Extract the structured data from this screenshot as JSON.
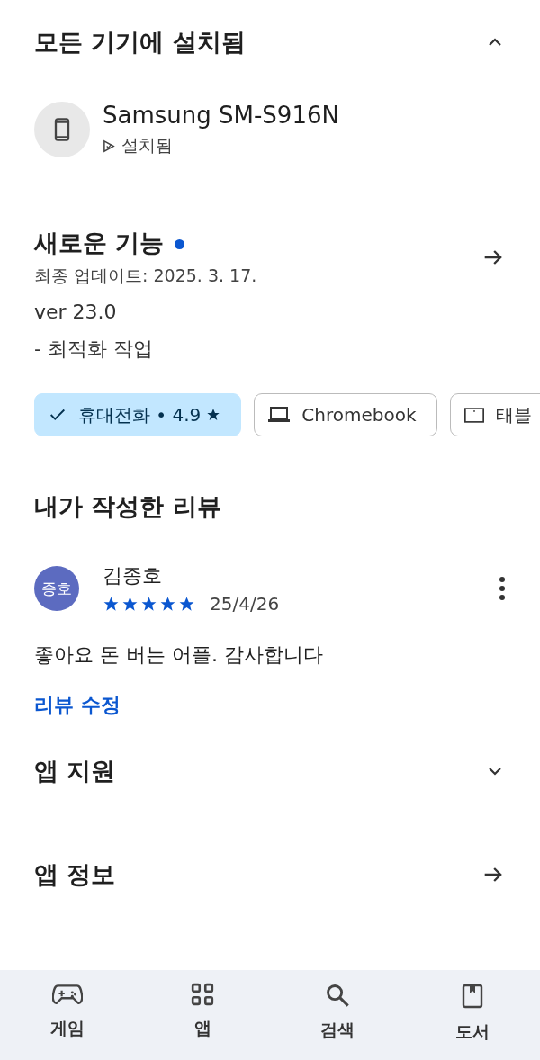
{
  "installed_section": {
    "title": "모든 기기에 설치됨",
    "expanded": true,
    "devices": [
      {
        "name": "Samsung SM-S916N",
        "status": "설치됨"
      }
    ]
  },
  "whats_new": {
    "title": "새로운 기능",
    "new_badge": true,
    "updated": "최종 업데이트: 2025. 3. 17.",
    "lines": [
      "ver 23.0",
      "- 최적화 작업"
    ]
  },
  "device_chips": [
    {
      "kind": "phone",
      "label": "휴대전화 • 4.9",
      "selected": true
    },
    {
      "kind": "laptop",
      "label": "Chromebook",
      "selected": false
    },
    {
      "kind": "tablet",
      "label": "태블",
      "selected": false
    }
  ],
  "my_review": {
    "title": "내가 작성한 리뷰",
    "avatar": "종호",
    "author": "김종호",
    "stars": 5,
    "date": "25/4/26",
    "text": "좋아요 돈 버는 어플. 감사합니다",
    "edit_link": "리뷰 수정"
  },
  "sections": [
    {
      "kind": "expand",
      "title": "앱 지원",
      "expanded": false
    },
    {
      "kind": "link",
      "title": "앱 정보"
    }
  ],
  "bottom_nav": [
    {
      "kind": "games",
      "label": "게임"
    },
    {
      "kind": "apps",
      "label": "앱"
    },
    {
      "kind": "search",
      "label": "검색"
    },
    {
      "kind": "books",
      "label": "도서"
    }
  ]
}
